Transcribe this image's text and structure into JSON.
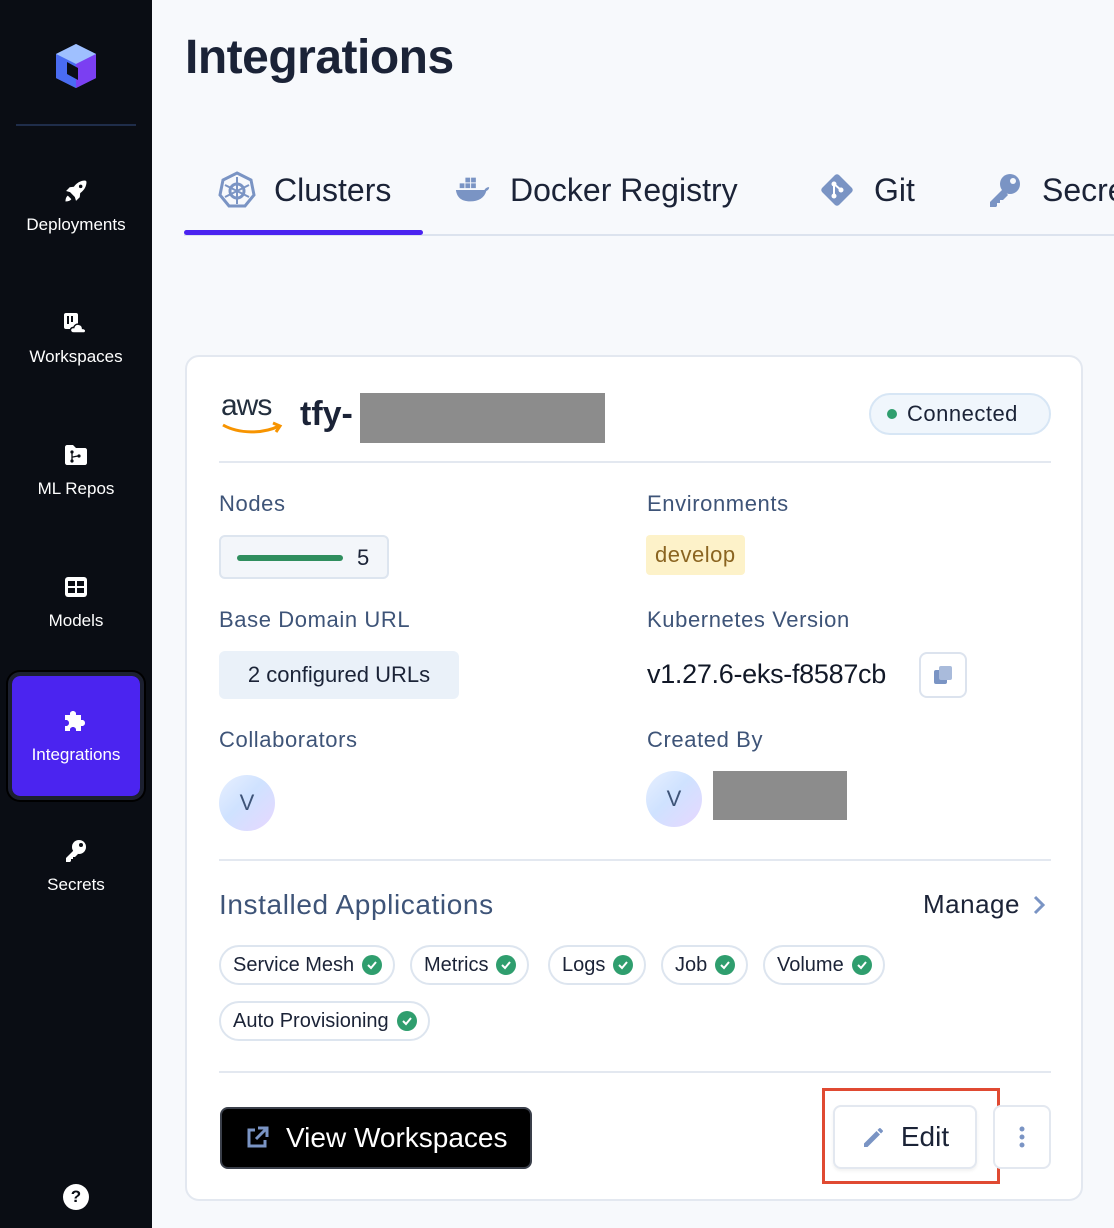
{
  "sidebar": {
    "items": [
      {
        "label": "Deployments",
        "icon": "rocket-icon"
      },
      {
        "label": "Workspaces",
        "icon": "workspaces-icon"
      },
      {
        "label": "ML Repos",
        "icon": "folder-branch-icon"
      },
      {
        "label": "Models",
        "icon": "grid-icon"
      },
      {
        "label": "Integrations",
        "icon": "puzzle-icon",
        "active": true
      },
      {
        "label": "Secrets",
        "icon": "key-icon"
      }
    ],
    "help": "?"
  },
  "page": {
    "title": "Integrations"
  },
  "tabs": [
    {
      "label": "Clusters",
      "icon": "kubernetes-icon",
      "active": true
    },
    {
      "label": "Docker Registry",
      "icon": "docker-icon"
    },
    {
      "label": "Git",
      "icon": "git-icon"
    },
    {
      "label": "Secre",
      "icon": "key-icon"
    }
  ],
  "card": {
    "provider": "aws",
    "cluster_name": "tfy-",
    "status": "Connected",
    "nodes": {
      "label": "Nodes",
      "count": "5"
    },
    "environments": {
      "label": "Environments",
      "values": [
        "develop"
      ]
    },
    "base_domain": {
      "label": "Base Domain URL",
      "value": "2 configured URLs"
    },
    "k8s": {
      "label": "Kubernetes Version",
      "value": "v1.27.6-eks-f8587cb"
    },
    "collaborators": {
      "label": "Collaborators",
      "initial": "V"
    },
    "created_by": {
      "label": "Created By",
      "initial": "V"
    },
    "apps": {
      "title": "Installed Applications",
      "manage": "Manage",
      "items": [
        "Service Mesh",
        "Metrics",
        "Logs",
        "Job",
        "Volume",
        "Auto Provisioning"
      ]
    },
    "actions": {
      "view": "View Workspaces",
      "edit": "Edit"
    }
  },
  "colors": {
    "accent": "#4b24f0",
    "success": "#2f9e6e",
    "highlight": "#e04a32"
  }
}
